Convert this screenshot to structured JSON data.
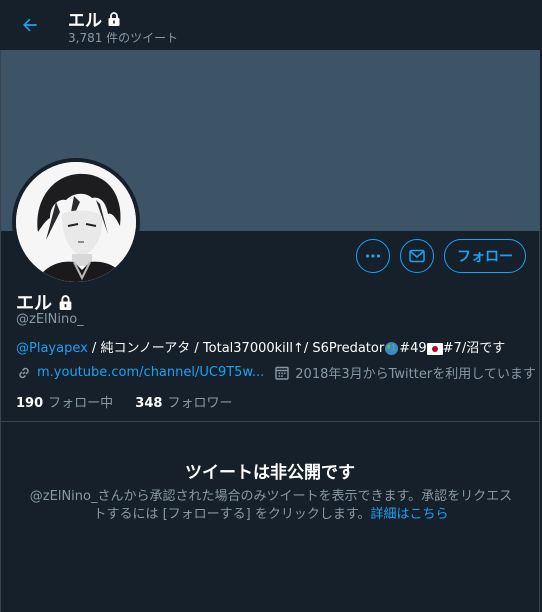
{
  "header": {
    "title": "エル",
    "tweet_count": "3,781 件のツイート"
  },
  "profile": {
    "name": "エル",
    "handle": "@zElNino_",
    "bio_mention": "@Playapex",
    "bio_text_1": " / 純コンノーアタ / Total37000kill↑/ S6Predator",
    "bio_text_2": "#49",
    "bio_text_3": "#7/沼です",
    "link": "m.youtube.com/channel/UC9T5w...",
    "joined": "2018年3月からTwitterを利用しています",
    "following_count": "190",
    "following_label": "フォロー中",
    "followers_count": "348",
    "followers_label": "フォロワー"
  },
  "actions": {
    "follow_label": "フォロー"
  },
  "private": {
    "title": "ツイートは非公開です",
    "message": "@zElNino_さんから承認された場合のみツイートを表示できます。承認をリクエストするには [フォローする] をクリックします。",
    "learn_more": "詳細はこちら"
  },
  "colors": {
    "background": "#15202b",
    "banner": "#3d5466",
    "accent": "#1da1f2",
    "muted": "#8899a6"
  },
  "icons": [
    "back-arrow-icon",
    "lock-icon",
    "more-icon",
    "mail-icon",
    "link-icon",
    "calendar-icon",
    "globe-icon",
    "japan-flag-icon"
  ]
}
